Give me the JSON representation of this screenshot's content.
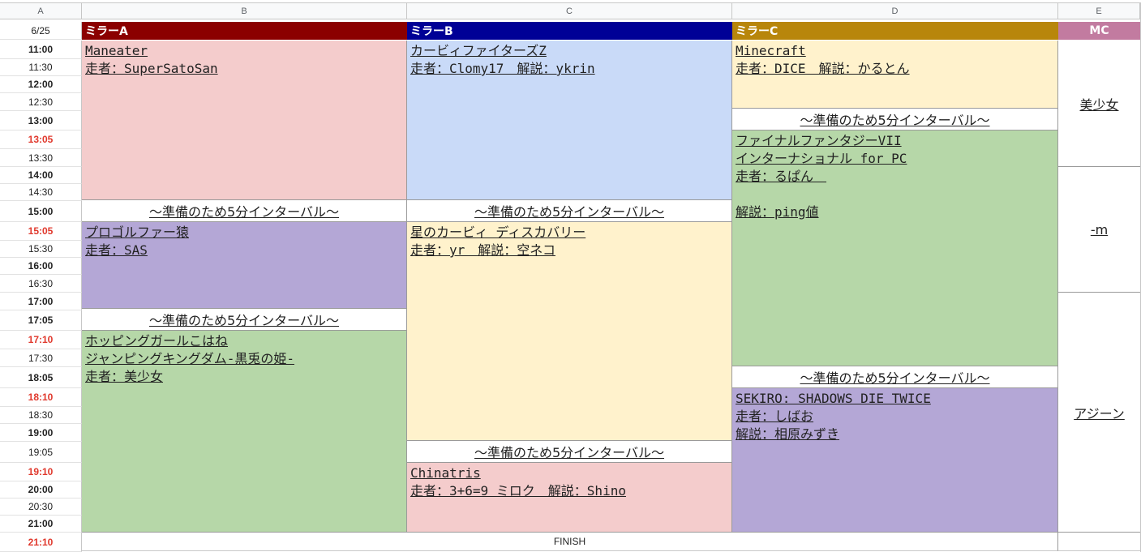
{
  "columns": [
    "A",
    "B",
    "C",
    "D",
    "E"
  ],
  "date": "6/25",
  "times": [
    {
      "label": "11:00",
      "style": "b"
    },
    {
      "label": "11:30",
      "style": ""
    },
    {
      "label": "12:00",
      "style": "b"
    },
    {
      "label": "12:30",
      "style": ""
    },
    {
      "label": "13:00",
      "style": "b"
    },
    {
      "label": "13:05",
      "style": "r"
    },
    {
      "label": "13:30",
      "style": ""
    },
    {
      "label": "14:00",
      "style": "b"
    },
    {
      "label": "14:30",
      "style": ""
    },
    {
      "label": "15:00",
      "style": "b"
    },
    {
      "label": "15:05",
      "style": "r"
    },
    {
      "label": "15:30",
      "style": ""
    },
    {
      "label": "16:00",
      "style": "b"
    },
    {
      "label": "16:30",
      "style": ""
    },
    {
      "label": "17:00",
      "style": "b"
    },
    {
      "label": "17:05",
      "style": "b"
    },
    {
      "label": "17:10",
      "style": "r"
    },
    {
      "label": "17:30",
      "style": ""
    },
    {
      "label": "18:05",
      "style": "b"
    },
    {
      "label": "18:10",
      "style": "r"
    },
    {
      "label": "18:30",
      "style": ""
    },
    {
      "label": "19:00",
      "style": "b"
    },
    {
      "label": "19:05",
      "style": ""
    },
    {
      "label": "19:10",
      "style": "r"
    },
    {
      "label": "20:00",
      "style": "b"
    },
    {
      "label": "20:30",
      "style": ""
    },
    {
      "label": "21:00",
      "style": "b"
    },
    {
      "label": "21:10",
      "style": "r"
    }
  ],
  "headers": {
    "mirror_a": "ミラーA",
    "mirror_b": "ミラーB",
    "mirror_c": "ミラーC",
    "mc": "MC"
  },
  "header_colors": {
    "mirror_a": "#8b0000",
    "mirror_b": "#000096",
    "mirror_c": "#b8860b",
    "mc": "#c27ba0"
  },
  "interval_text": "～準備のため5分インターバル～",
  "mirror_a": {
    "run1": {
      "title": "Maneater",
      "runner": "走者：SuperSatoSan"
    },
    "run2": {
      "title": "プロゴルファー猿",
      "runner": "走者：SAS"
    },
    "run3": {
      "title": "ホッピングガールこはね",
      "title2": "ジャンピングキングダム-黒兎の姫-",
      "runner": "走者：美少女"
    }
  },
  "mirror_b": {
    "run1": {
      "title": "カービィファイターズZ",
      "runner": "走者：Clomy17　解説：ykrin"
    },
    "run2": {
      "title": "星のカービィ ディスカバリー",
      "runner": "走者：yr　解説：空ネコ"
    },
    "run3": {
      "title": "Chinatris",
      "runner": "走者：3+6=9 ミロク　解説：Shino"
    }
  },
  "mirror_c": {
    "run1": {
      "title": "Minecraft",
      "runner": "走者：DICE　解説：かるとん"
    },
    "run2": {
      "title": "ファイナルファンタジーVII",
      "title2": "インターナショナル for PC",
      "runner": "走者：るぱん　",
      "commentary": "解説：ping値"
    },
    "run3": {
      "title": "SEKIRO: SHADOWS DIE TWICE",
      "runner": "走者：しばお",
      "commentary": "解説：相原みずき"
    }
  },
  "mc_list": [
    "美少女",
    "-m",
    "アジーン"
  ],
  "finish": "FINISH"
}
